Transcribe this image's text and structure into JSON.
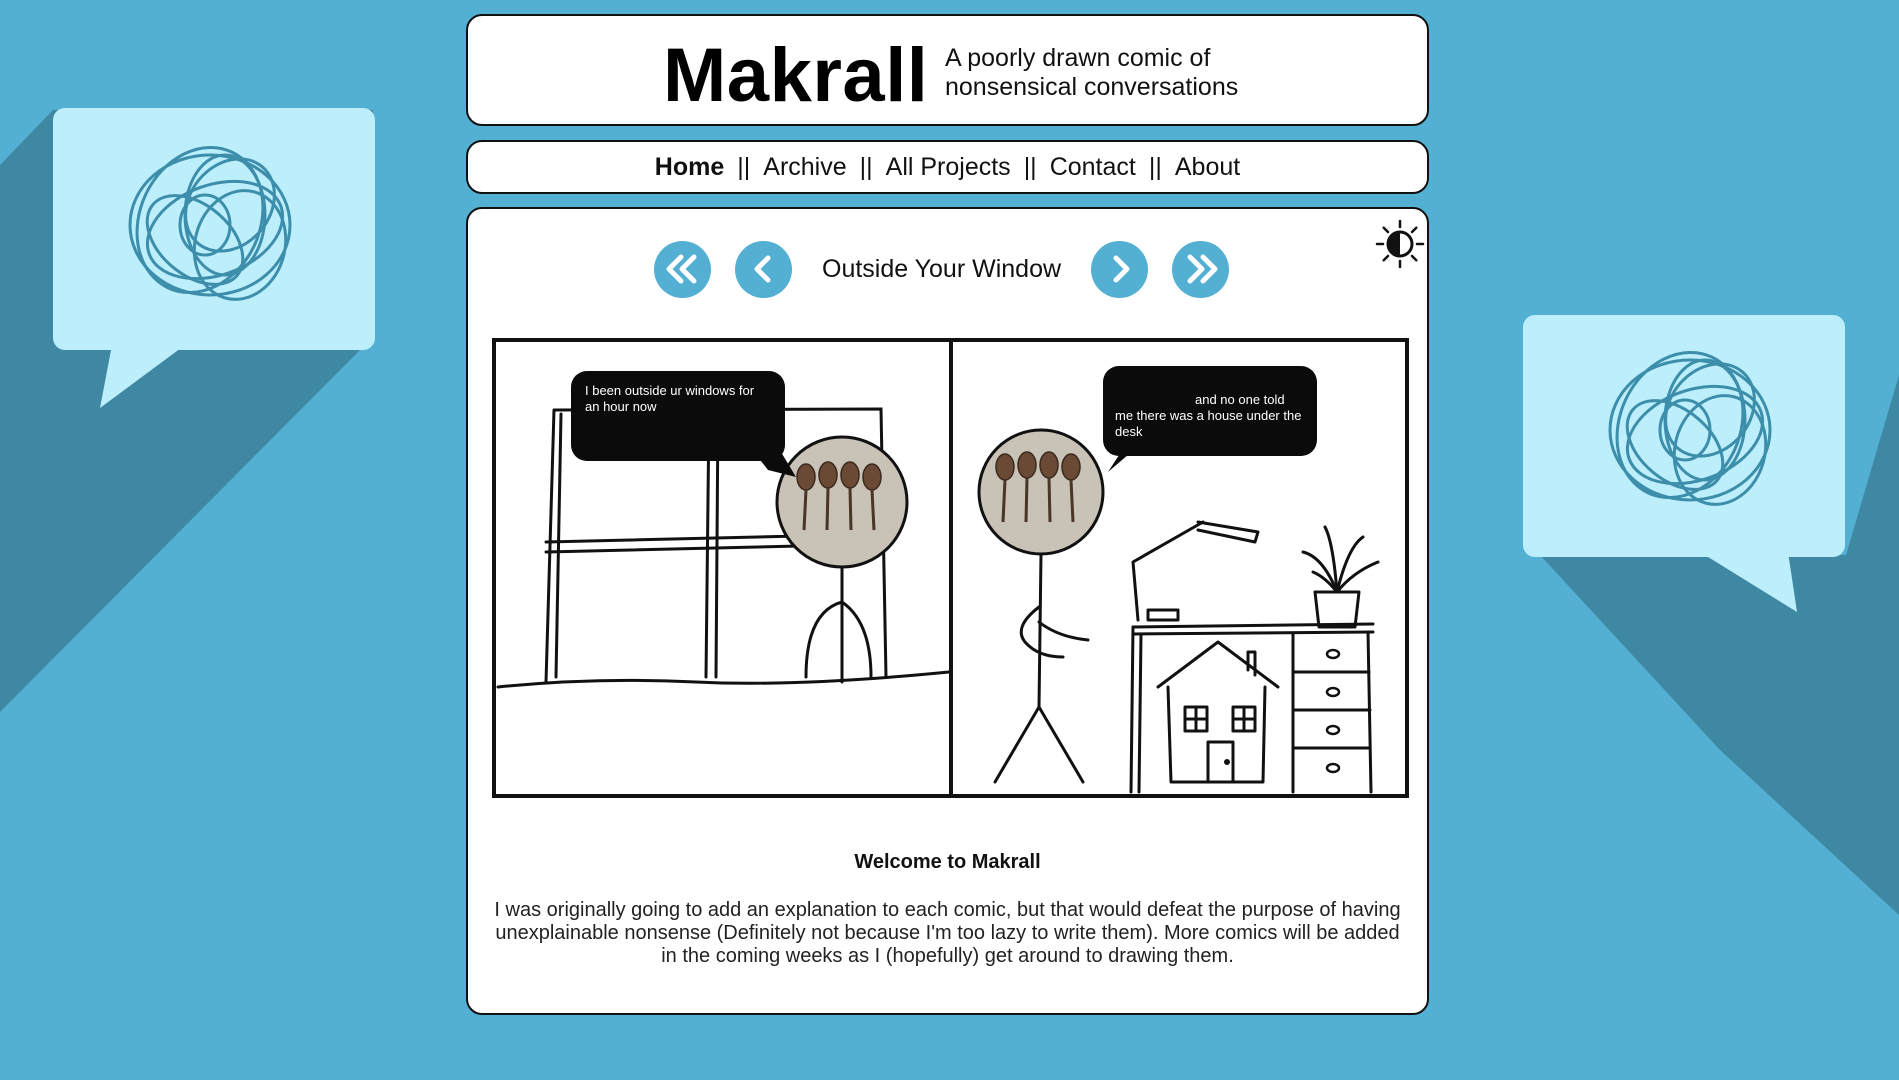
{
  "site": {
    "title": "Makrall",
    "tagline": "A poorly drawn comic of nonsensical conversations"
  },
  "nav": {
    "items": [
      "Home",
      "Archive",
      "All Projects",
      "Contact",
      "About"
    ],
    "active": "Home",
    "separator": "||"
  },
  "comic": {
    "title": "Outside Your Window",
    "panel1_bubble": "I been outside ur windows for an hour now",
    "panel2_bubble": "and no one told me there was a house under the desk"
  },
  "welcome": {
    "title": "Welcome to Makrall",
    "text": "I was originally going to add an explanation to each comic, but that would defeat the purpose of having unexplainable nonsense (Definitely not because I'm too lazy to write them). More comics will be added in the coming weeks as I (hopefully) get around to drawing them."
  },
  "icons": {
    "theme_toggle": "contrast-sun-icon",
    "first": "double-chevron-left-icon",
    "prev": "chevron-left-icon",
    "next": "chevron-right-icon",
    "last": "double-chevron-right-icon"
  },
  "colors": {
    "background": "#53b0d3",
    "bubble_light": "#bdeefb",
    "shadow": "#3f88a3",
    "scribble": "#3c8eab",
    "nav_button": "#53b0d3"
  }
}
